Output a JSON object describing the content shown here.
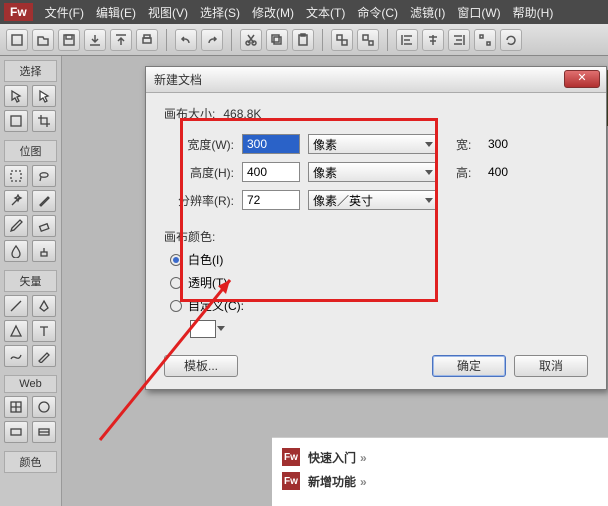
{
  "menubar": {
    "logo": "Fw",
    "items": [
      "文件(F)",
      "编辑(E)",
      "视图(V)",
      "选择(S)",
      "修改(M)",
      "文本(T)",
      "命令(C)",
      "滤镜(I)",
      "窗口(W)",
      "帮助(H)"
    ]
  },
  "toolbar_icons": [
    "new",
    "open",
    "save",
    "import",
    "export",
    "print",
    "undo",
    "redo",
    "cut",
    "copy",
    "paste",
    "group",
    "ungroup",
    "align-l",
    "align-c",
    "align-r",
    "distribute",
    "rotate"
  ],
  "left": {
    "section_select": "选择",
    "section_bitmap": "位图",
    "section_vector": "矢量",
    "section_web": "Web",
    "section_color": "颜色"
  },
  "doc_logo": "Fw",
  "cards": {
    "quickstart": "快速入门",
    "whatsnew": "新增功能",
    "arrow": "»"
  },
  "dialog": {
    "title": "新建文档",
    "canvas_size_lbl": "画布大小:",
    "canvas_size_val": "468.8K",
    "width_lbl": "宽度(W):",
    "width_val": "300",
    "height_lbl": "高度(H):",
    "height_val": "400",
    "res_lbl": "分辨率(R):",
    "res_val": "72",
    "unit_px": "像素",
    "unit_ppi": "像素／英寸",
    "side_w_lbl": "宽:",
    "side_w_val": "300",
    "side_h_lbl": "高:",
    "side_h_val": "400",
    "canvas_color_lbl": "画布颜色:",
    "opt_white": "白色(I)",
    "opt_transparent": "透明(T)",
    "opt_custom": "自定义(C):",
    "btn_template": "模板...",
    "btn_ok": "确定",
    "btn_cancel": "取消"
  }
}
